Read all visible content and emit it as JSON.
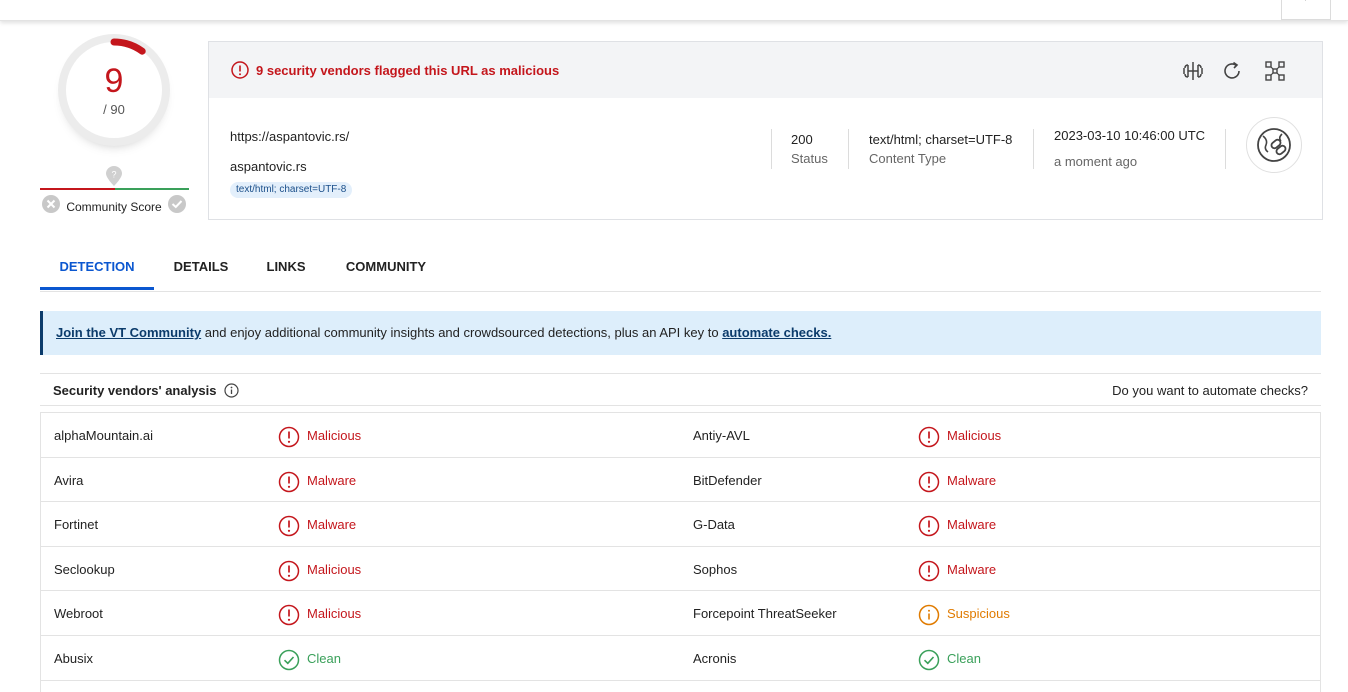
{
  "score": {
    "detections": "9",
    "total": "/ 90",
    "community_label": "Community Score"
  },
  "alert": {
    "text": "9 security vendors flagged this URL as malicious"
  },
  "summary": {
    "url": "https://aspantovic.rs/",
    "domain": "aspantovic.rs",
    "tag": "text/html; charset=UTF-8",
    "status_value": "200",
    "status_label": "Status",
    "content_type_value": "text/html; charset=UTF-8",
    "content_type_label": "Content Type",
    "date_value": "2023-03-10 10:46:00 UTC",
    "date_relative": "a moment ago"
  },
  "header_icons": [
    "compare-icon",
    "reanalyze-icon",
    "graph-icon"
  ],
  "tabs": [
    {
      "label": "DETECTION",
      "active": true
    },
    {
      "label": "DETAILS",
      "active": false
    },
    {
      "label": "LINKS",
      "active": false
    },
    {
      "label": "COMMUNITY",
      "active": false
    }
  ],
  "banner": {
    "link1": "Join the VT Community",
    "middle": " and enjoy additional community insights and crowdsourced detections, plus an API key to ",
    "link2": "automate checks."
  },
  "analysis": {
    "title": "Security vendors' analysis",
    "automate": "Do you want to automate checks?"
  },
  "colors": {
    "malicious": "#c4161c",
    "suspicious": "#e07b00",
    "clean": "#3aa05a",
    "accent": "#0b57d0"
  },
  "vendors": [
    [
      {
        "name": "alphaMountain.ai",
        "result": "Malicious",
        "status": "malicious"
      },
      {
        "name": "Antiy-AVL",
        "result": "Malicious",
        "status": "malicious"
      }
    ],
    [
      {
        "name": "Avira",
        "result": "Malware",
        "status": "malicious"
      },
      {
        "name": "BitDefender",
        "result": "Malware",
        "status": "malicious"
      }
    ],
    [
      {
        "name": "Fortinet",
        "result": "Malware",
        "status": "malicious"
      },
      {
        "name": "G-Data",
        "result": "Malware",
        "status": "malicious"
      }
    ],
    [
      {
        "name": "Seclookup",
        "result": "Malicious",
        "status": "malicious"
      },
      {
        "name": "Sophos",
        "result": "Malware",
        "status": "malicious"
      }
    ],
    [
      {
        "name": "Webroot",
        "result": "Malicious",
        "status": "malicious"
      },
      {
        "name": "Forcepoint ThreatSeeker",
        "result": "Suspicious",
        "status": "suspicious"
      }
    ],
    [
      {
        "name": "Abusix",
        "result": "Clean",
        "status": "clean"
      },
      {
        "name": "Acronis",
        "result": "Clean",
        "status": "clean"
      }
    ]
  ]
}
